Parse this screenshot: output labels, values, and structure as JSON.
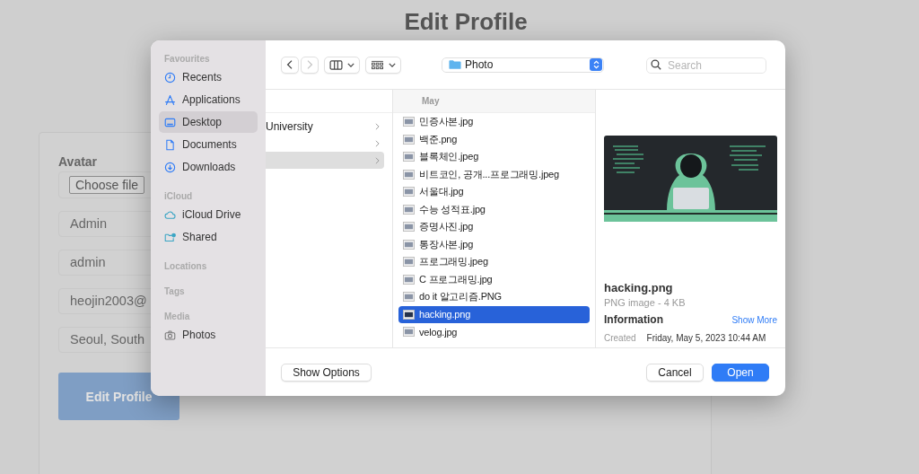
{
  "page": {
    "title": "Edit Profile",
    "avatar_label": "Avatar",
    "choose_file": "Choose file",
    "fields": [
      {
        "value": "Admin"
      },
      {
        "value": "admin"
      },
      {
        "value": "heojin2003@"
      },
      {
        "value": "Seoul, South"
      }
    ],
    "submit": "Edit Profile"
  },
  "dialog": {
    "sidebar": [
      {
        "heading": "Favourites",
        "items": [
          {
            "label": "Recents",
            "kind": "clock",
            "selected": false
          },
          {
            "label": "Applications",
            "kind": "apps",
            "selected": false
          },
          {
            "label": "Desktop",
            "kind": "desktop",
            "selected": true
          },
          {
            "label": "Documents",
            "kind": "document",
            "selected": false
          },
          {
            "label": "Downloads",
            "kind": "download",
            "selected": false
          }
        ]
      },
      {
        "heading": "iCloud",
        "items": [
          {
            "label": "iCloud Drive",
            "kind": "cloud",
            "selected": false
          },
          {
            "label": "Shared",
            "kind": "shared",
            "selected": false
          }
        ]
      },
      {
        "heading": "Locations"
      },
      {
        "heading": "Tags"
      },
      {
        "heading": "Media",
        "items": [
          {
            "label": "Photos",
            "kind": "camera",
            "selected": false
          }
        ]
      }
    ],
    "toolbar": {
      "back_disabled": false,
      "forward_disabled": true,
      "location": "Photo",
      "search_placeholder": "Search"
    },
    "column_1": [
      {
        "label": "University",
        "selected": false
      },
      {
        "selected": false
      },
      {
        "selected": true
      }
    ],
    "files_header": "May",
    "files": [
      {
        "name": "민증사본.jpg",
        "selected": false
      },
      {
        "name": "백준.png",
        "selected": false
      },
      {
        "name": "블록체인.jpeg",
        "selected": false
      },
      {
        "name": "비트코인, 공개...프로그래밍.jpeg",
        "selected": false
      },
      {
        "name": "서울대.jpg",
        "selected": false
      },
      {
        "name": "수능 성적표.jpg",
        "selected": false
      },
      {
        "name": "증명사진.jpg",
        "selected": false
      },
      {
        "name": "통장사본.jpg",
        "selected": false
      },
      {
        "name": "프로그래밍.jpeg",
        "selected": false
      },
      {
        "name": "C 프로그래밍.jpg",
        "selected": false
      },
      {
        "name": "do it 알고리즘.PNG",
        "selected": false
      },
      {
        "name": "hacking.png",
        "selected": true
      },
      {
        "name": "velog.jpg",
        "selected": false
      }
    ],
    "preview": {
      "name": "hacking.png",
      "type": "PNG image - 4 KB",
      "info_heading": "Information",
      "show_more": "Show More",
      "created_label": "Created",
      "created_value": "Friday, May 5, 2023 10:44 AM"
    },
    "footer": {
      "options": "Show Options",
      "cancel": "Cancel",
      "open": "Open"
    }
  }
}
